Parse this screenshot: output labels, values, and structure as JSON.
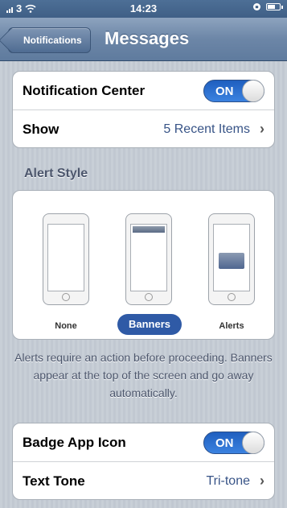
{
  "status_bar": {
    "carrier": "3",
    "time": "14:23"
  },
  "nav": {
    "back_label": "Notifications",
    "title": "Messages"
  },
  "group1": {
    "notification_center_label": "Notification Center",
    "notification_center_toggle": "ON",
    "show_label": "Show",
    "show_value": "5 Recent Items"
  },
  "alert_style": {
    "header": "Alert Style",
    "options": [
      "None",
      "Banners",
      "Alerts"
    ],
    "selected": "Banners"
  },
  "description": "Alerts require an action before proceeding. Banners appear at the top of the screen and go away automatically.",
  "group2": {
    "badge_label": "Badge App Icon",
    "badge_toggle": "ON",
    "tone_label": "Text Tone",
    "tone_value": "Tri-tone"
  },
  "colors": {
    "toggle_on": "#2f6fd0",
    "selected_pill": "#2f5aa6",
    "value_text": "#385487"
  }
}
